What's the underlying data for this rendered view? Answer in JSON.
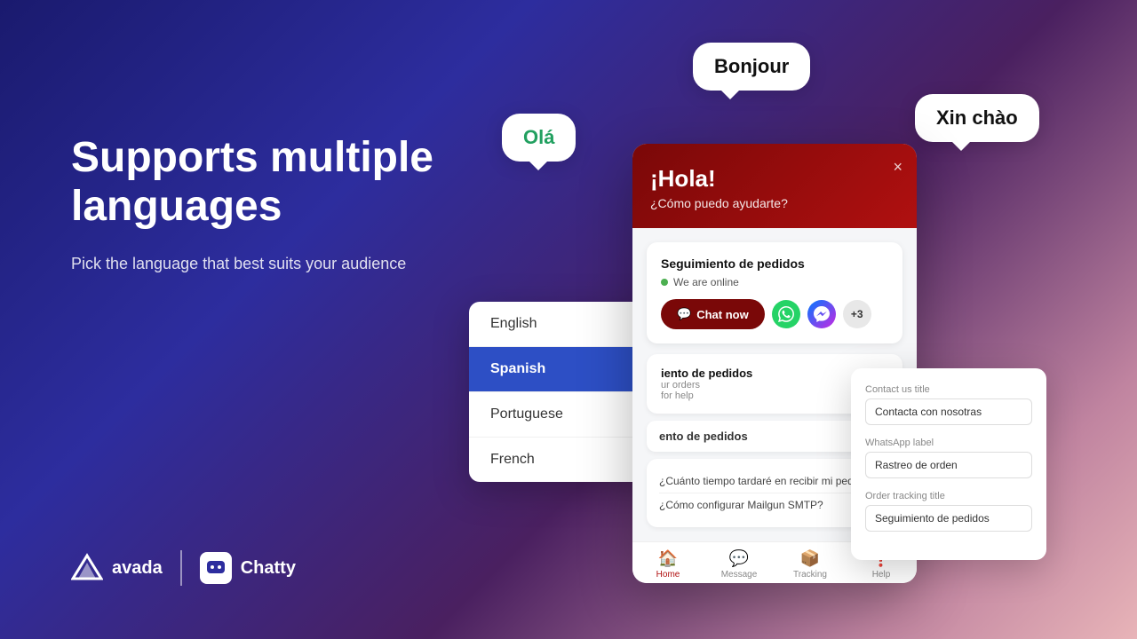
{
  "background": {
    "gradient_start": "#1a1a6e",
    "gradient_end": "#e8b4b8"
  },
  "bubbles": {
    "bonjour": "Bonjour",
    "xin_chao": "Xin chào",
    "ola": "Olá"
  },
  "hero": {
    "title": "Supports multiple languages",
    "subtitle": "Pick the language that best suits your audience"
  },
  "logos": {
    "avada": "avada",
    "chatty": "Chatty"
  },
  "language_panel": {
    "items": [
      {
        "label": "English",
        "active": false
      },
      {
        "label": "Spanish",
        "active": true
      },
      {
        "label": "Portuguese",
        "active": false
      },
      {
        "label": "French",
        "active": false
      }
    ]
  },
  "chat_widget": {
    "header": {
      "greeting": "¡Hola!",
      "subtext": "¿Cómo puedo ayudarte?",
      "close_label": "×"
    },
    "order_card": {
      "title": "Seguimiento de pedidos",
      "online_text": "We are online",
      "chat_now": "Chat now",
      "plus_count": "+3"
    },
    "section2": {
      "title": "iento de pedidos",
      "sub": "ur orders",
      "sub2": "for help"
    },
    "section3_title": "ento de pedidos",
    "messages": [
      "¿Cuánto tiempo tardaré en recibir mi pedido?",
      "¿Cómo configurar Mailgun SMTP?"
    ],
    "nav": [
      {
        "icon": "🏠",
        "label": "Home",
        "active": true
      },
      {
        "icon": "💬",
        "label": "Message",
        "active": false
      },
      {
        "icon": "📦",
        "label": "Tracking",
        "active": false
      },
      {
        "icon": "❓",
        "label": "Help",
        "active": false
      }
    ]
  },
  "settings_panel": {
    "fields": [
      {
        "label": "Contact us title",
        "value": "Contacta con nosotras"
      },
      {
        "label": "WhatsApp label",
        "value": "Rastreo de orden"
      },
      {
        "label": "Order tracking title",
        "value": "Seguimiento de pedidos"
      }
    ]
  }
}
